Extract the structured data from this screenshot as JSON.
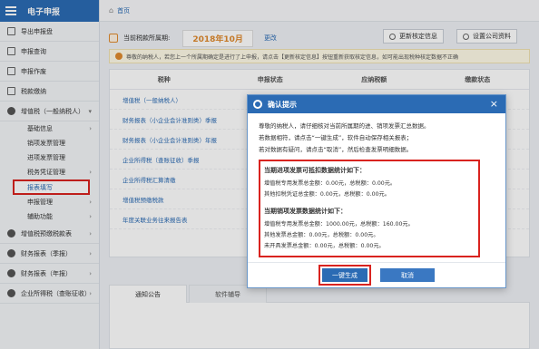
{
  "app": {
    "title": "电子申报"
  },
  "breadcrumb": {
    "home": "首页"
  },
  "sidebar": {
    "items": [
      {
        "label": "导出申报盘"
      },
      {
        "label": "申报查询"
      },
      {
        "label": "申报作废"
      },
      {
        "label": "税款缴纳"
      },
      {
        "label": "增值税（一般纳税人）"
      }
    ],
    "subitems": [
      {
        "label": "基础信息"
      },
      {
        "label": "销项发票管理"
      },
      {
        "label": "进项发票管理"
      },
      {
        "label": "税务凭证管理"
      },
      {
        "label": "报表填写"
      },
      {
        "label": "申报管理"
      },
      {
        "label": "辅助功能"
      }
    ],
    "lower_items": [
      {
        "label": "增值税预缴税款表"
      },
      {
        "label": "财务报表（季报）"
      },
      {
        "label": "财务报表（年报）"
      },
      {
        "label": "企业所得税（查账征收）"
      }
    ]
  },
  "main": {
    "period_label": "当前税款所属期:",
    "period_value": "2018年10月",
    "change_link": "更改",
    "refresh_button": "更新核定信息",
    "settings_button": "设置公司资料",
    "notice": "尊敬的纳税人，若您上一个所属期确定是进行了上申报，请点击【更新核定信息】按钮重新获取核定信息，如可能出现税种核定数据不正确",
    "table_headers": [
      "税种",
      "申报状态",
      "应纳税额",
      "缴款状态"
    ],
    "table_rows": [
      "增值税（一般纳税人）",
      "财务报表（小企业会计准则类）季报",
      "财务报表（小企业会计准则类）年报",
      "企业所得税（查账征收）季报",
      "企业所得税汇算清缴",
      "增值税预缴税款",
      "年度关联业务往来报告表"
    ],
    "tabs": [
      "通知公告",
      "软件辅导"
    ]
  },
  "dialog": {
    "title": "确认提示",
    "intro": [
      "尊敬的纳税人，请仔细核对当前所属期的进、销项发票汇总数据。",
      "若数据相符，请点击“一键生成”，软件自动保存相关报表；",
      "若对数据有疑问，请点击“取消”，然后检查发票明细数据。"
    ],
    "input_title": "当期进项发票可抵扣数据统计如下：",
    "input_lines": [
      "增值税专用发票总金额：0.00元，总税额：0.00元。",
      "其他扣税凭证总金额：0.00元，总税额：0.00元。"
    ],
    "output_title": "当期销项发票数据统计如下：",
    "output_lines": [
      "增值税专用发票总金额：1000.00元，总税额：160.00元。",
      "其他发票总金额：0.00元，总税额：0.00元。",
      "未开具发票总金额：0.00元，总税额：0.00元。"
    ],
    "generate_button": "一键生成",
    "cancel_button": "取消"
  }
}
